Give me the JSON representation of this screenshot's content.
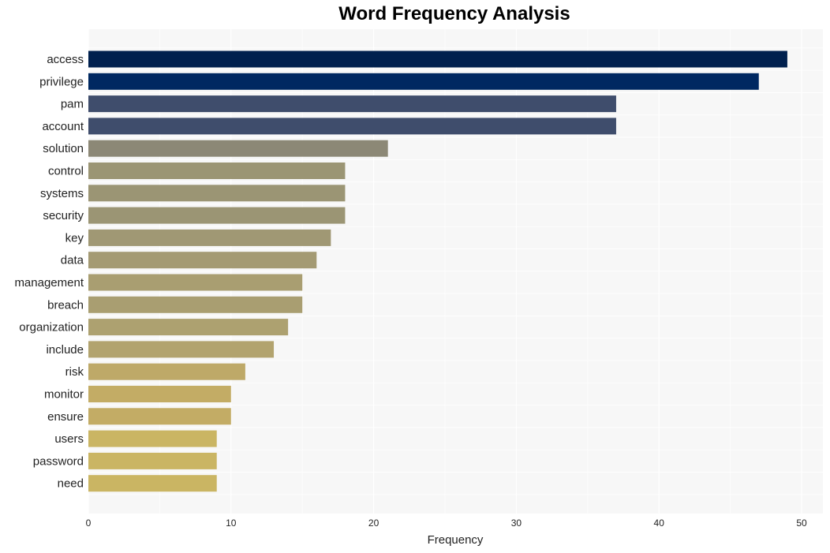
{
  "chart_data": {
    "type": "bar",
    "orientation": "horizontal",
    "title": "Word Frequency Analysis",
    "xlabel": "Frequency",
    "ylabel": "",
    "xlim": [
      0,
      51.5
    ],
    "xticks": [
      0,
      10,
      20,
      30,
      40,
      50
    ],
    "grid": true,
    "categories": [
      "access",
      "privilege",
      "pam",
      "account",
      "solution",
      "control",
      "systems",
      "security",
      "key",
      "data",
      "management",
      "breach",
      "organization",
      "include",
      "risk",
      "monitor",
      "ensure",
      "users",
      "password",
      "need"
    ],
    "values": [
      49,
      47,
      37,
      37,
      21,
      18,
      18,
      18,
      17,
      16,
      15,
      15,
      14,
      13,
      11,
      10,
      10,
      9,
      9,
      9
    ],
    "colors": [
      "#00204e",
      "#002861",
      "#3f4d6c",
      "#3f4d6c",
      "#8c8876",
      "#9b9574",
      "#9b9574",
      "#9b9574",
      "#a09874",
      "#a49a73",
      "#a99e71",
      "#a99e71",
      "#ada170",
      "#b2a36e",
      "#bea968",
      "#c3ac65",
      "#c3ac65",
      "#cab563",
      "#cab563",
      "#cab563"
    ]
  }
}
